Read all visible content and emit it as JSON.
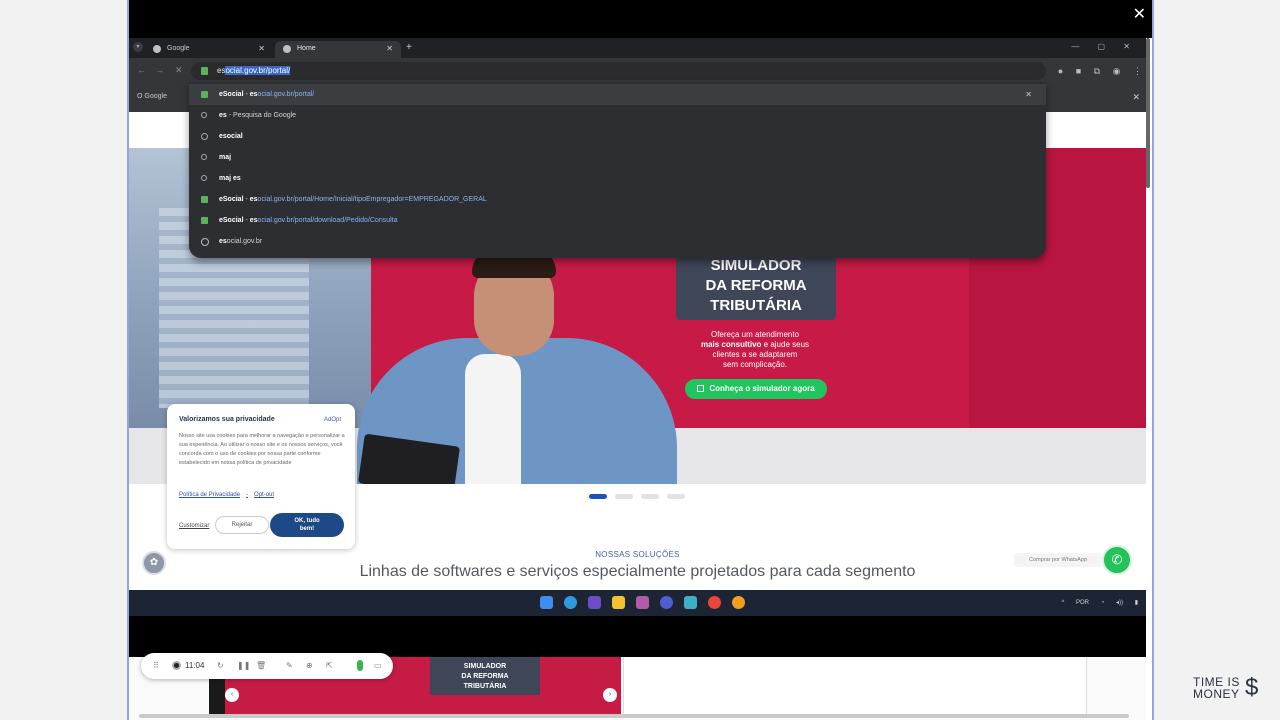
{
  "browser": {
    "tabs": [
      {
        "label": "Google"
      },
      {
        "label": "Home"
      }
    ],
    "address": {
      "typed_prefix": "es",
      "selected_text": "ocial.gov.br/portal/"
    },
    "bookmark": "O Google",
    "suggestions": [
      {
        "bold": "eSocial",
        "sep": " - ",
        "url_bold": "es",
        "url": "ocial.gov.br/portal/"
      },
      {
        "bold": "es",
        "text": " - Pesquisa do Google"
      },
      {
        "bold": "esocial",
        "text": ""
      },
      {
        "bold": "maj",
        "text": ""
      },
      {
        "bold": "maj es",
        "text": ""
      },
      {
        "bold": "eSocial",
        "sep": " - ",
        "url_bold": "es",
        "url": "ocial.gov.br/portal/Home/Inicial/tipoEmpregador=EMPREGADOR_GERAL"
      },
      {
        "bold": "eSocial",
        "sep": " - ",
        "url_bold": "es",
        "url": "ocial.gov.br/portal/download/Pedido/Consulta"
      },
      {
        "bold": "es",
        "text": "ocial.gov.br"
      }
    ]
  },
  "hero": {
    "promo_title_1": "SIMULADOR",
    "promo_title_2": "DA REFORMA",
    "promo_title_3": "TRIBUTÁRIA",
    "desc_1": "Ofereça um atendimento",
    "desc_2_bold": "mais consultivo",
    "desc_2_rest": " e ajude seus",
    "desc_3": "clientes a se adaptarem",
    "desc_4": "sem complicação.",
    "cta": "Conheça o simulador agora"
  },
  "section": {
    "kicker": "NOSSAS SOLUÇÕES",
    "title": "Linhas de softwares e serviços especialmente projetados para cada segmento"
  },
  "cookie": {
    "title": "Valorizamos sua privacidade",
    "adopt": "AdOpt",
    "text": "Nosso site usa cookies para melhorar a navegação e personalizar a sua experiência. Ao utilizar o nosso site e os nossos serviços, você concorda com o uso de cookies por nossa parte conforme estabelecido em nossa política de privacidade",
    "link_policy": "Política de Privacidade",
    "link_optout": "Opt-out",
    "customize": "Customizar",
    "reject": "Rejeitar",
    "ok_line1": "OK, tudo",
    "ok_line2": "bem!"
  },
  "whatsapp": {
    "label": "Comprar por WhatsApp"
  },
  "taskbar": {
    "lang": "POR"
  },
  "recorder": {
    "time": "11:04"
  },
  "thumbnail": {
    "promo_1": "SIMULADOR",
    "promo_2": "DA REFORMA",
    "promo_3": "TRIBUTÁRIA"
  },
  "brand": {
    "line1": "TIME IS",
    "line2": "MONEY"
  },
  "colors": {
    "hero_red": "#c81a46",
    "cta_green": "#20c55d",
    "ok_blue": "#1d4a86",
    "whatsapp_green": "#23c25a"
  }
}
